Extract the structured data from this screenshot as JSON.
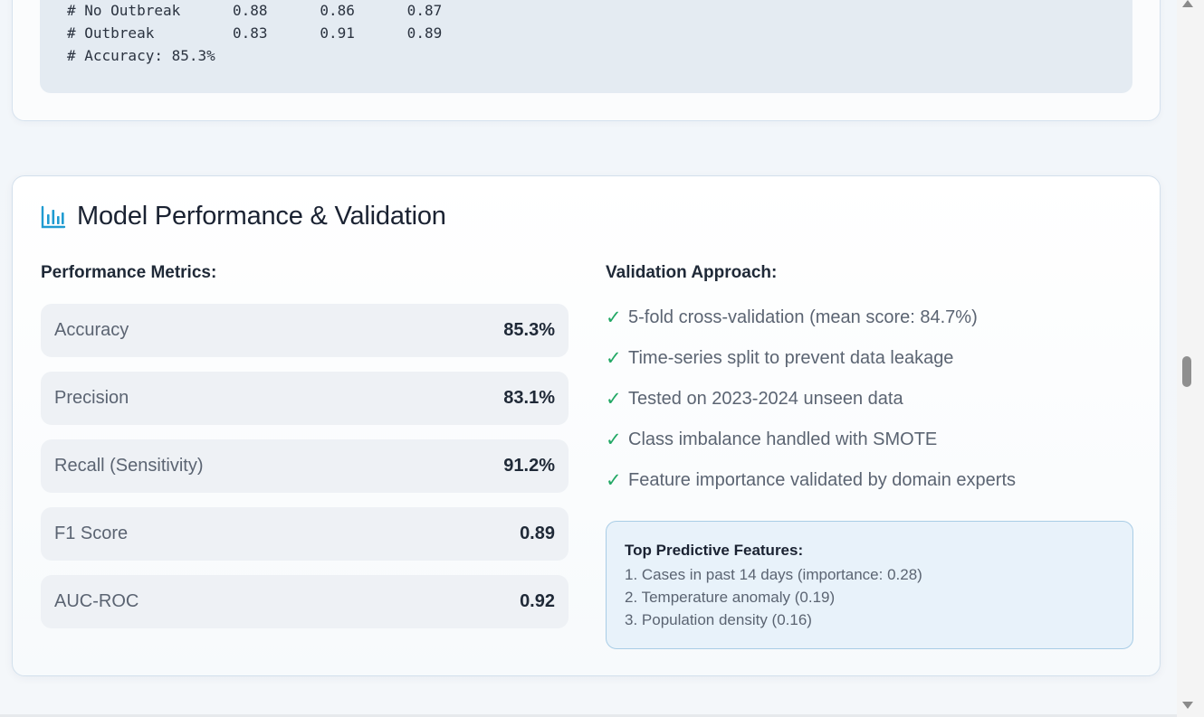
{
  "code": {
    "lines": [
      "# No Outbreak      0.88      0.86      0.87",
      "# Outbreak         0.83      0.91      0.89",
      "# Accuracy: 85.3%"
    ]
  },
  "section": {
    "icon": "bar-chart-icon",
    "title": "Model Performance & Validation",
    "metrics_heading": "Performance Metrics:",
    "validation_heading": "Validation Approach:"
  },
  "metrics": [
    {
      "label": "Accuracy",
      "value": "85.3%"
    },
    {
      "label": "Precision",
      "value": "83.1%"
    },
    {
      "label": "Recall (Sensitivity)",
      "value": "91.2%"
    },
    {
      "label": "F1 Score",
      "value": "0.89"
    },
    {
      "label": "AUC-ROC",
      "value": "0.92"
    }
  ],
  "validation": {
    "check_symbol": "✓",
    "items": [
      "5-fold cross-validation (mean score: 84.7%)",
      "Time-series split to prevent data leakage",
      "Tested on 2023-2024 unseen data",
      "Class imbalance handled with SMOTE",
      "Feature importance validated by domain experts"
    ]
  },
  "features": {
    "title": "Top Predictive Features:",
    "items": [
      "1. Cases in past 14 days (importance: 0.28)",
      "2. Temperature anomaly (0.19)",
      "3. Population density (0.16)"
    ]
  },
  "colors": {
    "accent": "#1f9bd1",
    "check": "#22a865"
  }
}
